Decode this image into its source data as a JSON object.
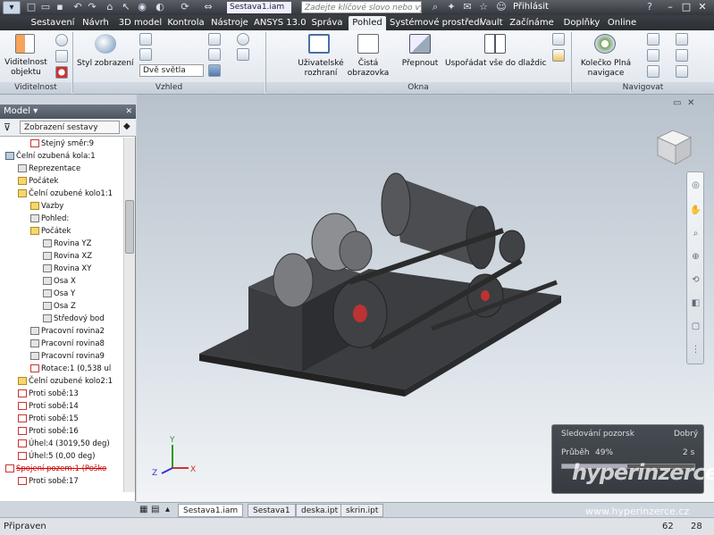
{
  "titlebar": {
    "file_name": "Sestava1.iam",
    "search_placeholder": "Zadejte klíčové slovo nebo výraz",
    "signin_label": "Přihlásit"
  },
  "tabs": [
    "Sestavení",
    "Návrh",
    "3D model",
    "Kontrola",
    "Nástroje",
    "ANSYS 13.0",
    "Správa",
    "Pohled",
    "Systémové prostředí",
    "Vault",
    "Začínáme",
    "Doplňky",
    "Online"
  ],
  "active_tab": "Pohled",
  "ribbon": {
    "visibility_button": "Viditelnost objektu",
    "visibility_group": "Viditelnost",
    "style_button": "Styl zobrazení",
    "lighting_select": "Dvě světla",
    "view_group": "Vzhled",
    "user_interface_button": "Uživatelské rozhraní",
    "clean_screen_button": "Čistá obrazovka",
    "switch_button": "Přepnout",
    "arrange_button": "Uspořádat vše do dlaždic",
    "windows_group": "Okna",
    "wheel_button": "Kolečko Plná navigace",
    "navigate_group": "Navigovat"
  },
  "browser": {
    "header": "Model",
    "view_select": "Zobrazení sestavy",
    "tree": [
      {
        "label": "Stejný směr:9",
        "indent": 2,
        "icon": "r"
      },
      {
        "label": "Čelní ozubená kola:1",
        "indent": 0,
        "icon": "b"
      },
      {
        "label": "Reprezentace",
        "indent": 1,
        "icon": "g"
      },
      {
        "label": "Počátek",
        "indent": 1,
        "icon": "y"
      },
      {
        "label": "Čelní ozubené kolo1:1",
        "indent": 1,
        "icon": "y"
      },
      {
        "label": "Vazby",
        "indent": 2,
        "icon": "y"
      },
      {
        "label": "Pohled:",
        "indent": 2,
        "icon": "g"
      },
      {
        "label": "Počátek",
        "indent": 2,
        "icon": "y"
      },
      {
        "label": "Rovina YZ",
        "indent": 3,
        "icon": "g"
      },
      {
        "label": "Rovina XZ",
        "indent": 3,
        "icon": "g"
      },
      {
        "label": "Rovina XY",
        "indent": 3,
        "icon": "g"
      },
      {
        "label": "Osa X",
        "indent": 3,
        "icon": "g"
      },
      {
        "label": "Osa Y",
        "indent": 3,
        "icon": "g"
      },
      {
        "label": "Osa Z",
        "indent": 3,
        "icon": "g"
      },
      {
        "label": "Středový bod",
        "indent": 3,
        "icon": "g"
      },
      {
        "label": "Pracovní rovina2",
        "indent": 2,
        "icon": "g"
      },
      {
        "label": "Pracovní rovina8",
        "indent": 2,
        "icon": "g"
      },
      {
        "label": "Pracovní rovina9",
        "indent": 2,
        "icon": "g"
      },
      {
        "label": "Rotace:1 (0,538 ul",
        "indent": 2,
        "icon": "r"
      },
      {
        "label": "Čelní ozubené kolo2:1",
        "indent": 1,
        "icon": "y"
      },
      {
        "label": "Proti sobě:13",
        "indent": 1,
        "icon": "r"
      },
      {
        "label": "Proti sobě:14",
        "indent": 1,
        "icon": "r"
      },
      {
        "label": "Proti sobě:15",
        "indent": 1,
        "icon": "r"
      },
      {
        "label": "Proti sobě:16",
        "indent": 1,
        "icon": "r"
      },
      {
        "label": "Úhel:4 (3019,50 deg)",
        "indent": 1,
        "icon": "r"
      },
      {
        "label": "Úhel:5 (0,00 deg)",
        "indent": 1,
        "icon": "r"
      },
      {
        "label": "Spojení pozem:1 (Poško",
        "indent": 0,
        "icon": "r",
        "error": true
      },
      {
        "label": "Proti sobě:17",
        "indent": 1,
        "icon": "r"
      }
    ]
  },
  "progress": {
    "title": "Sledování pozorsk",
    "status": "Dobrý",
    "label": "Průběh",
    "percent_text": "49%",
    "percent": 0.49,
    "time": "2 s"
  },
  "doc_tabs": [
    "Sestava1.iam",
    "Sestava1",
    "deska.ipt",
    "skrin.ipt"
  ],
  "active_doc": "Sestava1.iam",
  "status": {
    "text": "Připraven",
    "num1": "62",
    "num2": "28"
  },
  "watermark": {
    "brand": "hyperinzerce",
    "url": "www.hyperinzerce.cz"
  },
  "axis_labels": {
    "x": "X",
    "y": "Y",
    "z": "Z"
  }
}
